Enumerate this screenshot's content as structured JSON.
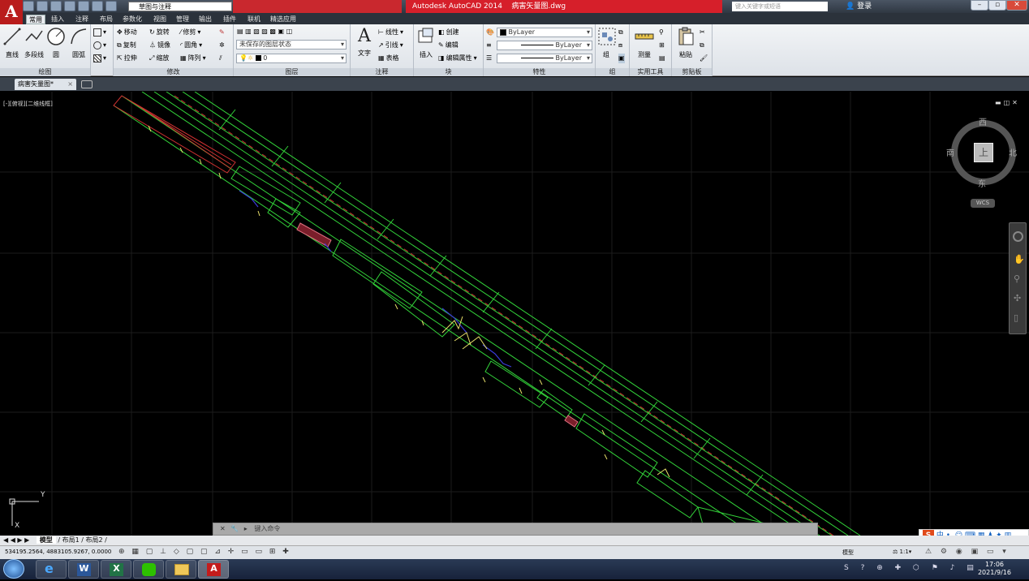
{
  "titlebar": {
    "workspace": "草图与注释",
    "title": "Autodesk AutoCAD 2014",
    "filename": "病害矢量图.dwg",
    "badge": "",
    "search_placeholder": "键入关键字或短语",
    "login": "登录"
  },
  "menu_tabs": [
    "常用",
    "插入",
    "注释",
    "布局",
    "参数化",
    "视图",
    "管理",
    "输出",
    "插件",
    "联机",
    "精选应用"
  ],
  "active_tab": "常用",
  "ribbon": {
    "draw": {
      "title": "绘图",
      "line": "直线",
      "polyline": "多段线",
      "circle": "圆",
      "arc": "圆弧"
    },
    "modify": {
      "title": "修改",
      "move": "移动",
      "rotate": "旋转",
      "trim": "修剪",
      "copy": "复制",
      "mirror": "镜像",
      "fillet": "圆角",
      "stretch": "拉伸",
      "scale": "缩放",
      "array": "阵列"
    },
    "layers": {
      "title": "图层",
      "state": "未保存的图层状态",
      "current": "0"
    },
    "annotation": {
      "title": "注释",
      "text": "文字",
      "linear": "线性",
      "leader": "引线",
      "table": "表格"
    },
    "block": {
      "title": "块",
      "insert": "插入",
      "create": "创建",
      "edit": "编辑",
      "edit_attr": "编辑属性"
    },
    "properties": {
      "title": "特性",
      "color": "ByLayer",
      "linetype": "ByLayer",
      "lineweight": "ByLayer"
    },
    "groups": {
      "title": "组",
      "group": "组"
    },
    "utilities": {
      "title": "实用工具",
      "measure": "测量"
    },
    "clipboard": {
      "title": "剪贴板",
      "paste": "粘贴"
    }
  },
  "file_tab": "病害矢量图*",
  "viewport": {
    "label": "[-][俯视][二维线框]",
    "viewcube": {
      "top": "上",
      "north": "北",
      "south": "南",
      "east": "东",
      "west": "西",
      "wcs": "WCS"
    }
  },
  "command": {
    "placeholder": "键入命令"
  },
  "layout_tabs": [
    "模型",
    "布局1",
    "布局2"
  ],
  "status": {
    "coords": "534195.2564, 4883105.9267, 0.0000",
    "model": "模型",
    "scale": "1:1"
  },
  "taskbar": {
    "time": "17:06",
    "date": "2021/9/16"
  },
  "ime": {
    "label": "中"
  }
}
